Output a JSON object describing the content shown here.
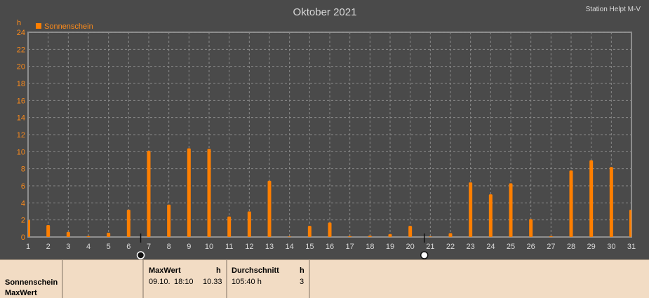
{
  "header": {
    "title": "Oktober 2021",
    "station": "Station Helpt M-V",
    "unit": "h"
  },
  "colors": {
    "background": "#4a4a4a",
    "bar": "#ff7f00",
    "axis_text": "#ff8c1a",
    "grid": "#8a8a8a",
    "footer_bg": "#f2dcc4"
  },
  "chart_data": {
    "type": "bar",
    "legend": [
      "Sonnenschein"
    ],
    "ylabel": "h",
    "ylim": [
      0,
      24
    ],
    "yticks": [
      0,
      2,
      4,
      6,
      8,
      10,
      12,
      14,
      16,
      18,
      20,
      22,
      24
    ],
    "categories": [
      "1",
      "2",
      "3",
      "4",
      "5",
      "6",
      "7",
      "8",
      "9",
      "10",
      "11",
      "12",
      "13",
      "14",
      "15",
      "16",
      "17",
      "18",
      "19",
      "20",
      "21",
      "22",
      "23",
      "24",
      "25",
      "26",
      "27",
      "28",
      "29",
      "30",
      "31"
    ],
    "series": [
      {
        "name": "Sonnenschein",
        "values": [
          2.0,
          1.4,
          0.6,
          0.1,
          0.5,
          3.2,
          10.1,
          3.8,
          10.4,
          10.33,
          2.4,
          3.0,
          6.6,
          0.05,
          1.3,
          1.7,
          0.1,
          0.15,
          0.35,
          1.3,
          0.05,
          0.45,
          6.4,
          5.0,
          6.3,
          2.1,
          0.1,
          7.8,
          9.0,
          8.2,
          3.2
        ]
      }
    ],
    "grid": true,
    "legend_position": "top-left",
    "markers": [
      {
        "day": 6.6,
        "label": "●"
      },
      {
        "day": 20.7,
        "label": "○"
      }
    ]
  },
  "footer": {
    "label_col": [
      "Sonnenschein",
      "MaxWert"
    ],
    "max": {
      "title": "MaxWert",
      "unit": "h",
      "date": "09.10.",
      "time": "18:10",
      "value": "10.33"
    },
    "avg": {
      "title": "Durchschnitt",
      "unit": "h",
      "value": "105:40 h",
      "count": "3"
    }
  }
}
